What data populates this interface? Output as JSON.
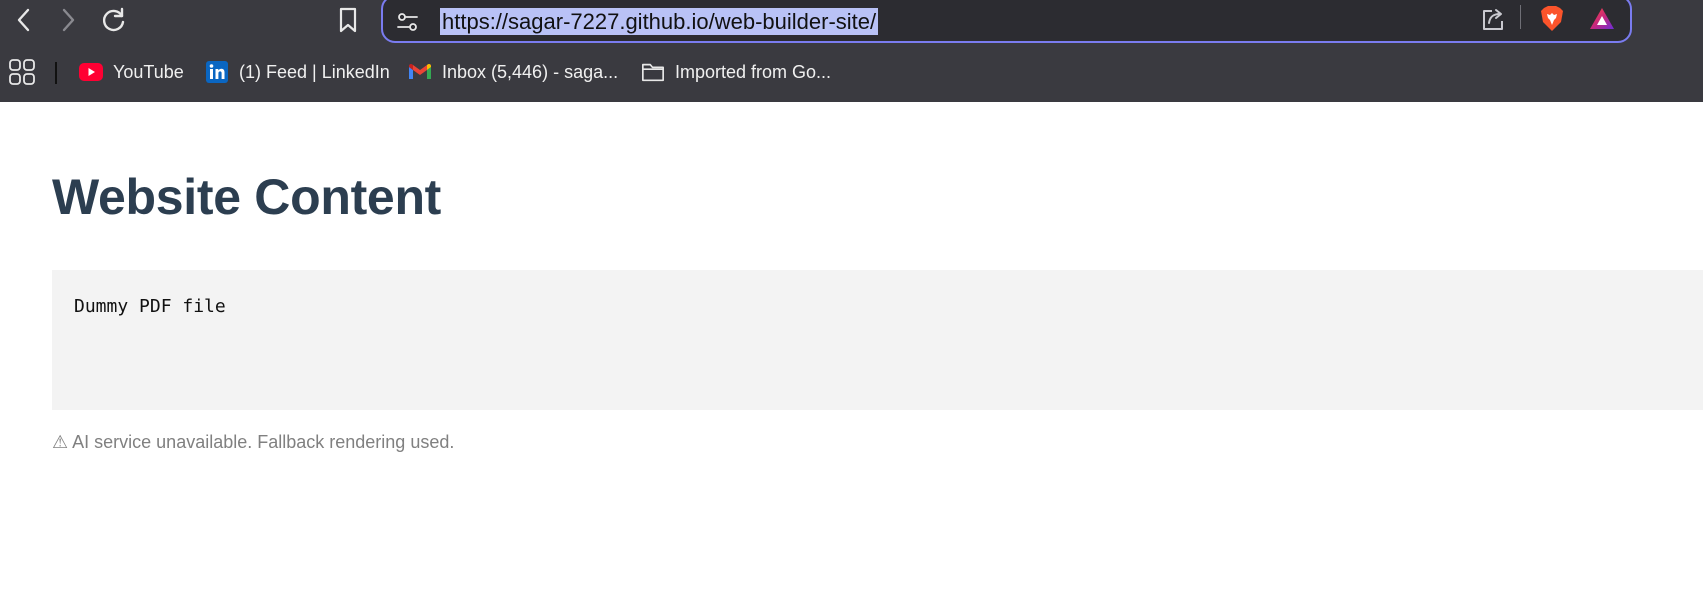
{
  "toolbar": {
    "back_icon": "chevron-left-icon",
    "forward_icon": "chevron-right-icon",
    "reload_icon": "reload-icon",
    "bookmark_icon": "bookmark-icon"
  },
  "address_bar": {
    "url": "https://sagar-7227.github.io/web-builder-site/",
    "site_settings_icon": "tune-icon",
    "share_icon": "share-icon",
    "brave_shields_icon": "brave-lion-icon",
    "brave_rewards_icon": "triangle-rewards-icon",
    "focus_color": "#7a7cf0",
    "selection_color": "#b9c2f6"
  },
  "bookmarks": {
    "apps_icon": "apps-grid-icon",
    "items": [
      {
        "label": "YouTube",
        "icon": "youtube-icon"
      },
      {
        "label": "(1) Feed | LinkedIn",
        "icon": "linkedin-icon"
      },
      {
        "label": "Inbox (5,446) - saga...",
        "icon": "gmail-icon"
      },
      {
        "label": "Imported from Go...",
        "icon": "folder-icon"
      }
    ]
  },
  "page": {
    "title": "Website Content",
    "content_text": "Dummy PDF file",
    "notice": "⚠ AI service unavailable. Fallback rendering used.",
    "title_color": "#2c3e50",
    "box_color": "#f3f3f3"
  }
}
